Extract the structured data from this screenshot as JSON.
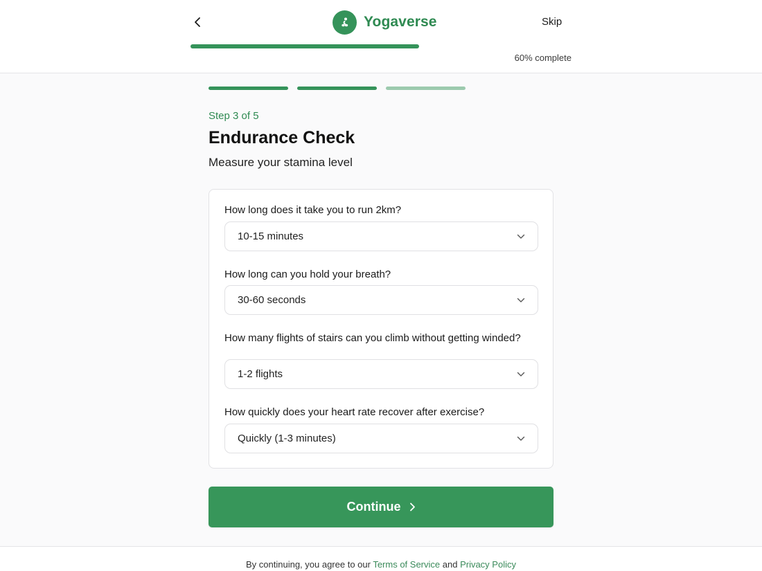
{
  "header": {
    "brand_name": "Yogaverse",
    "skip_label": "Skip",
    "progress_text": "60% complete",
    "progress_fraction": 0.6
  },
  "steps": {
    "total": 5,
    "segments_shown": 3,
    "completed": 2
  },
  "main": {
    "step_label": "Step 3 of 5",
    "title": "Endurance Check",
    "subtitle": "Measure your stamina level"
  },
  "questions": [
    {
      "label": "How long does it take you to run 2km?",
      "value": "10-15 minutes"
    },
    {
      "label": "How long can you hold your breath?",
      "value": "30-60 seconds"
    },
    {
      "label": "How many flights of stairs can you climb without getting winded?",
      "value": "1-2 flights"
    },
    {
      "label": "How quickly does your heart rate recover after exercise?",
      "value": "Quickly (1-3 minutes)"
    }
  ],
  "continue_label": "Continue",
  "footer": {
    "prefix": "By continuing, you agree to our ",
    "terms": "Terms of Service",
    "and": " and ",
    "privacy": "Privacy Policy"
  },
  "colors": {
    "accent": "#35935a",
    "accent_light": "#9ccaae",
    "link": "#3a8a5a"
  },
  "icons": {
    "back": "chevron-left-icon",
    "logo": "yoga-person-icon",
    "select": "chevron-down-icon",
    "continue": "chevron-right-icon"
  }
}
